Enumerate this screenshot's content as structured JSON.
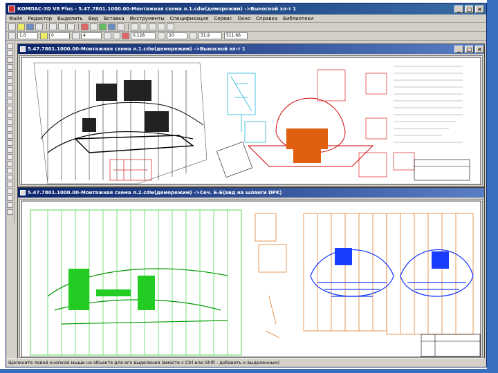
{
  "app": {
    "title": "КОМПАС-3D V8 Plus - 5.47.7801.1000.00-Монтажная схема л.1.cdw(деморежим) ->Выносной эл-т 1"
  },
  "menu": [
    "Файл",
    "Редактор",
    "Выделить",
    "Вид",
    "Вставка",
    "Инструменты",
    "Спецификация",
    "Сервис",
    "Окно",
    "Справка",
    "Библиотеки"
  ],
  "toolbar": {
    "field_style": "1.0",
    "field_layer": "0",
    "field_step": "4",
    "field_zoom": "0.128",
    "field_angle": "20",
    "field_coord": "31.9",
    "field_coord2": "511.66"
  },
  "documents": [
    {
      "title": "5.47.7801.1000.00-Монтажная схема л.1.cdw(деморежим) ->Выносной эл-т 1"
    },
    {
      "title": "5.47.7801.1000.00-Монтажная схема л.2.cdw(деморежим) ->Сеч. Б-Б(вид на шланги DPK)"
    }
  ],
  "status": {
    "text": "Щелкните левой кнопкой мыши на объекте для его выделения (вместе с Ctrl или Shift - добавить к выделенным)"
  },
  "colors": {
    "titlebar": "#0a246a",
    "drawing_black": "#000000",
    "drawing_red": "#d22222",
    "drawing_cyan": "#1fb8d8",
    "drawing_orange": "#e06010",
    "drawing_green": "#22cc22",
    "drawing_blue": "#1a3cff",
    "drawing_orange2": "#e08030"
  }
}
